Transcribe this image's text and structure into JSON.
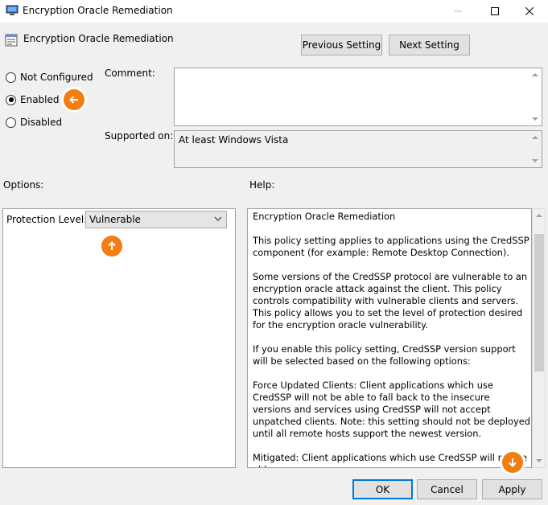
{
  "window": {
    "title": "Encryption Oracle Remediation"
  },
  "header": {
    "policy_title": "Encryption Oracle Remediation",
    "previous_setting": "Previous Setting",
    "next_setting": "Next Setting"
  },
  "state": {
    "not_configured": "Not Configured",
    "enabled": "Enabled",
    "disabled": "Disabled",
    "selected": "Enabled"
  },
  "comment": {
    "label": "Comment:",
    "value": ""
  },
  "supported": {
    "label": "Supported on:",
    "value": "At least Windows Vista"
  },
  "options": {
    "label": "Options:",
    "protection_label": "Protection Level:",
    "protection_value": "Vulnerable"
  },
  "help": {
    "label": "Help:",
    "paragraphs": [
      "Encryption Oracle Remediation",
      "This policy setting applies to applications using the CredSSP component (for example: Remote Desktop Connection).",
      "Some versions of the CredSSP protocol are vulnerable to an encryption oracle attack against the client.  This policy controls compatibility with vulnerable clients and servers.  This policy allows you to set the level of protection desired for the encryption oracle vulnerability.",
      "If you enable this policy setting, CredSSP version support will be selected based on the following options:",
      "Force Updated Clients: Client applications which use CredSSP will not be able to fall back to the insecure versions and services using CredSSP will not accept unpatched clients. Note: this setting should not be deployed until all remote hosts support the newest version.",
      "Mitigated: Client applications which use CredSSP will not be able"
    ]
  },
  "footer": {
    "ok": "OK",
    "cancel": "Cancel",
    "apply": "Apply"
  },
  "colors": {
    "accent": "#0078d7",
    "callout": "#f27d11"
  }
}
